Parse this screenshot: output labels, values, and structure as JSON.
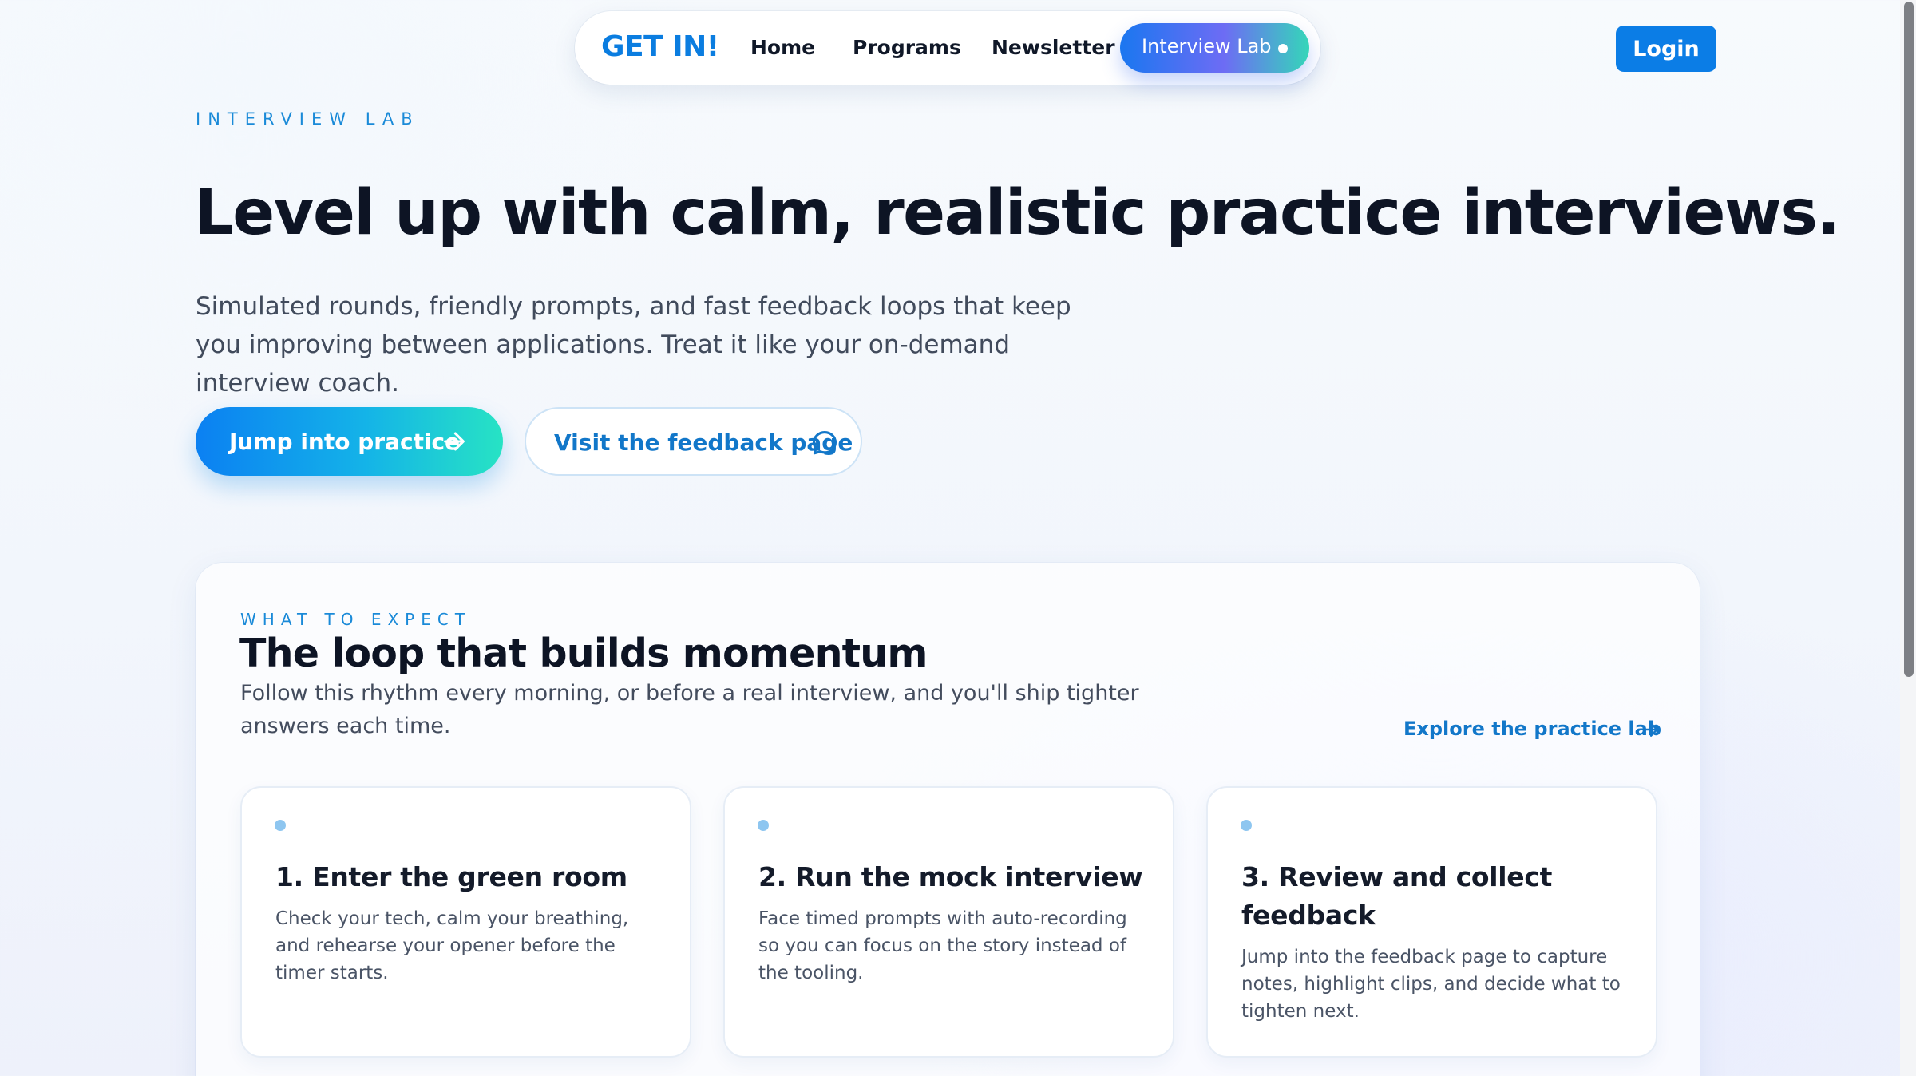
{
  "nav": {
    "brand": "GET IN!",
    "links": [
      "Home",
      "Programs",
      "Newsletter"
    ],
    "active": "Interview Lab",
    "login": "Login"
  },
  "hero": {
    "eyebrow": "INTERVIEW LAB",
    "title": "Level up with calm, realistic practice interviews.",
    "subtitle": "Simulated rounds, friendly prompts, and fast feedback loops that keep you improving between applications. Treat it like your on-demand interview coach.",
    "primary_cta": "Jump into practice",
    "secondary_cta": "Visit the feedback page"
  },
  "section": {
    "eyebrow": "WHAT TO EXPECT",
    "title": "The loop that builds momentum",
    "subtitle": "Follow this rhythm every morning, or before a real interview, and you'll ship tighter answers each time.",
    "link": "Explore the practice lab",
    "steps": [
      {
        "title": "1. Enter the green room",
        "body": "Check your tech, calm your breathing, and rehearse your opener before the timer starts."
      },
      {
        "title": "2. Run the mock interview",
        "body": "Face timed prompts with auto-recording so you can focus on the story instead of the tooling."
      },
      {
        "title": "3. Review and collect feedback",
        "body": "Jump into the feedback page to capture notes, highlight clips, and decide what to tighten next."
      }
    ]
  },
  "colors": {
    "brand": "#0b7de0",
    "accent": "#1a8ad8",
    "login": "#0b7de6"
  },
  "icons": {
    "primary_cta": "arrow-right-icon",
    "secondary_cta": "chat-bubble-icon",
    "section_link": "arrow-right-icon"
  }
}
